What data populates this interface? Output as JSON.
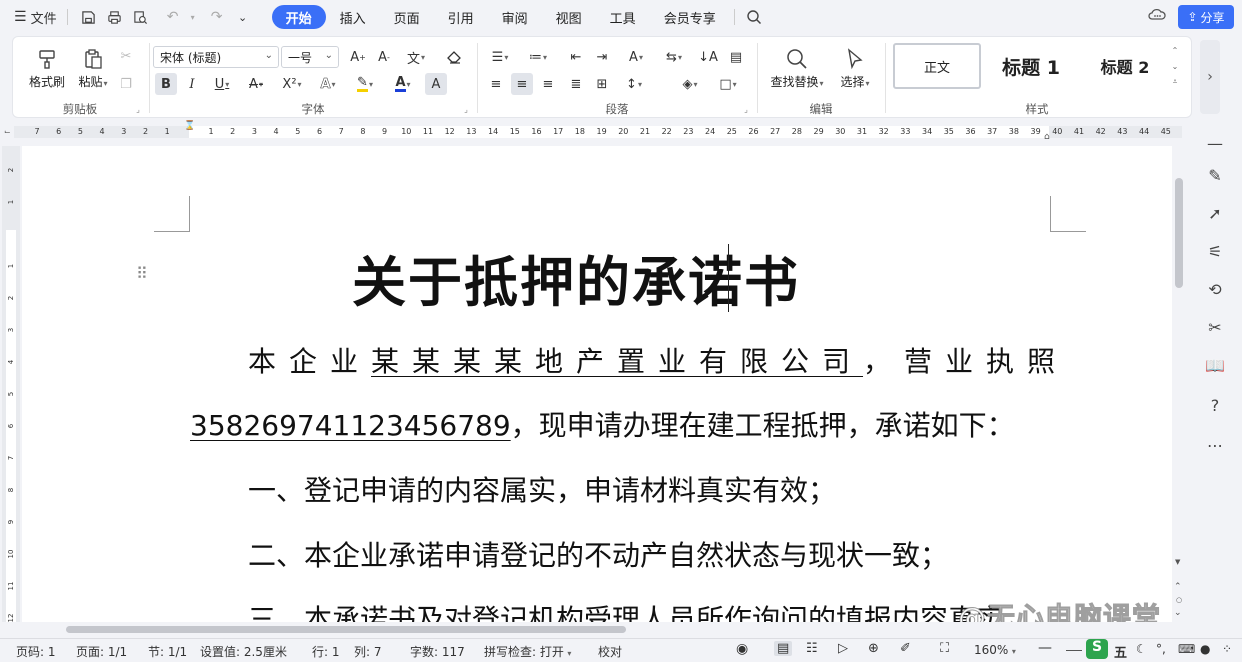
{
  "topbar": {
    "file_label": "文件",
    "tabs": [
      {
        "label": "开始",
        "active": true
      },
      {
        "label": "插入"
      },
      {
        "label": "页面"
      },
      {
        "label": "引用"
      },
      {
        "label": "审阅"
      },
      {
        "label": "视图"
      },
      {
        "label": "工具"
      },
      {
        "label": "会员专享"
      }
    ],
    "share_label": "分享",
    "accent_color": "#3a6ff7"
  },
  "ribbon": {
    "clipboard": {
      "format_painter": "格式刷",
      "paste": "粘贴",
      "group_label": "剪贴板"
    },
    "font": {
      "font_name": "宋体 (标题)",
      "font_size": "一号",
      "group_label": "字体"
    },
    "paragraph": {
      "group_label": "段落"
    },
    "editing": {
      "find_replace": "查找替换",
      "select": "选择",
      "group_label": "编辑"
    },
    "styles": {
      "normal": "正文",
      "heading1": "标题 1",
      "heading2": "标题 2",
      "group_label": "样式"
    }
  },
  "ruler": {
    "left_numbers": [
      "7",
      "6",
      "5",
      "4",
      "3",
      "2",
      "1"
    ],
    "right_numbers": [
      "1",
      "2",
      "3",
      "4",
      "5",
      "6",
      "7",
      "8",
      "9",
      "10",
      "11",
      "12",
      "13",
      "14",
      "15",
      "16",
      "17",
      "18",
      "19",
      "20",
      "21",
      "22",
      "23",
      "24",
      "25",
      "26",
      "27",
      "28",
      "29",
      "30",
      "31",
      "32",
      "33",
      "34",
      "35",
      "36",
      "37",
      "38",
      "39",
      "40",
      "41",
      "42",
      "43",
      "44",
      "45"
    ],
    "vertical_numbers": [
      "2",
      "1",
      "1",
      "2",
      "3",
      "4",
      "5",
      "6",
      "7",
      "8",
      "9",
      "10",
      "11",
      "12"
    ]
  },
  "document": {
    "title": "关于抵押的承诺书",
    "p1_prefix": "本企业",
    "p1_company": "某某某某地产置业有限公司",
    "p1_suffix": "，营业执照",
    "p2_license": "358269741123456789",
    "p2_rest": "，现申请办理在建工程抵押，承诺如下：",
    "item1": "一、登记申请的内容属实，申请材料真实有效；",
    "item2": "二、本企业承诺申请登记的不动产自然状态与现状一致；",
    "item3": "三、本承诺书及对登记机构受理人员所作询问的填报内容真实"
  },
  "status": {
    "page_no": "页码: 1",
    "pages": "页面: 1/1",
    "section": "节: 1/1",
    "setting": "设置值: 2.5厘米",
    "row": "行: 1",
    "col": "列: 7",
    "word_count": "字数: 117",
    "spell_check": "拼写检查: 打开",
    "proofread": "校对",
    "zoom": "160%",
    "ime": "五"
  },
  "watermark": "@无心电脑课堂"
}
